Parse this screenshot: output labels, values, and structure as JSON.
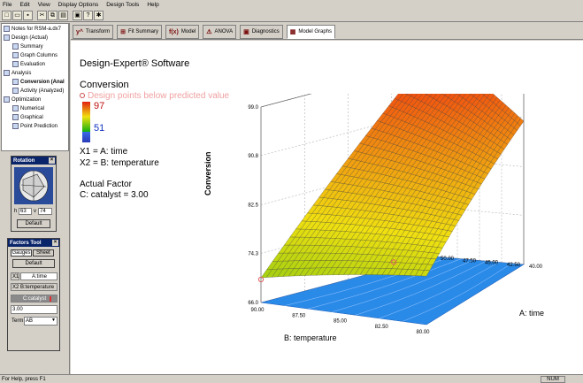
{
  "menu": [
    "File",
    "Edit",
    "View",
    "Display Options",
    "Design Tools",
    "Help"
  ],
  "toolbar_icons": [
    "new-icon",
    "open-icon",
    "save-icon",
    "cut-icon",
    "copy-icon",
    "paste-icon",
    "print-icon",
    "help-icon",
    "tip-icon"
  ],
  "tree": {
    "root": "Notes for RSM-a.dx7",
    "design": "Design (Actual)",
    "summary": "Summary",
    "graph_columns": "Graph Columns",
    "evaluation": "Evaluation",
    "analysis": "Analysis",
    "conversion": "Conversion (Anal",
    "activity": "Activity (Analyzed)",
    "optimization": "Optimization",
    "numerical": "Numerical",
    "graphical": "Graphical",
    "point_prediction": "Point Prediction"
  },
  "rotation": {
    "title": "Rotation",
    "h_label": "h",
    "h_value": "63",
    "v_label": "v",
    "v_value": "74",
    "default_label": "Default"
  },
  "factors_tool": {
    "title": "Factors Tool",
    "tab_gauges": "Gauges",
    "tab_sheet": "Sheet",
    "default_label": "Default",
    "x1_axis": "X1",
    "x1_name": "A:time",
    "x2_axis": "X2",
    "x2_name": "B:temperature",
    "slider_name": "C:catalyst",
    "slider_value": "3.00",
    "term_label": "Term",
    "term_value": "AB"
  },
  "tabs": [
    {
      "icon": "transform-icon",
      "glyph": "y^",
      "label": "Transform"
    },
    {
      "icon": "fit-summary-icon",
      "glyph": "⊞",
      "label": "Fit Summary"
    },
    {
      "icon": "model-icon",
      "glyph": "f(x)",
      "label": "Model"
    },
    {
      "icon": "anova-icon",
      "glyph": "⚠",
      "label": "ANOVA"
    },
    {
      "icon": "diagnostics-icon",
      "glyph": "▣",
      "label": "Diagnostics"
    },
    {
      "icon": "model-graphs-icon",
      "glyph": "▦",
      "label": "Model Graphs"
    }
  ],
  "graph_info": {
    "software": "Design-Expert® Software",
    "response": "Conversion",
    "legend_design_points": "Design points below predicted value",
    "high_value": "97",
    "low_value": "51",
    "x1_def": "X1 = A: time",
    "x2_def": "X2 = B: temperature",
    "actual_factor_title": "Actual Factor",
    "actual_factor_value": "C: catalyst = 3.00"
  },
  "colors": {
    "surface_high": "#e02010",
    "surface_mid": "#f0e010",
    "surface_low": "#10b010",
    "contour_floor": "#2a8ae8",
    "design_point": "#e06060"
  },
  "chart_data": {
    "type": "surface",
    "title": "",
    "zlabel": "Conversion",
    "xlabel": "A: time",
    "ylabel": "B: temperature",
    "z_ticks": [
      "66.0",
      "74.3",
      "82.5",
      "90.8",
      "99.0"
    ],
    "x_ticks": [
      "40.00",
      "42.50",
      "45.00",
      "47.50",
      "50.00"
    ],
    "y_ticks": [
      "80.00",
      "82.50",
      "85.00",
      "87.50",
      "90.00"
    ],
    "zlim": [
      66,
      99
    ],
    "xlim": [
      40,
      50
    ],
    "ylim": [
      80,
      90
    ],
    "corner_values": [
      {
        "time": 40,
        "temperature": 90,
        "conversion": 66
      },
      {
        "time": 50,
        "temperature": 90,
        "conversion": 97
      },
      {
        "time": 50,
        "temperature": 80,
        "conversion": 86
      },
      {
        "time": 40,
        "temperature": 80,
        "conversion": 70
      }
    ]
  },
  "status": {
    "help": "For Help, press F1",
    "num": "NUM"
  }
}
